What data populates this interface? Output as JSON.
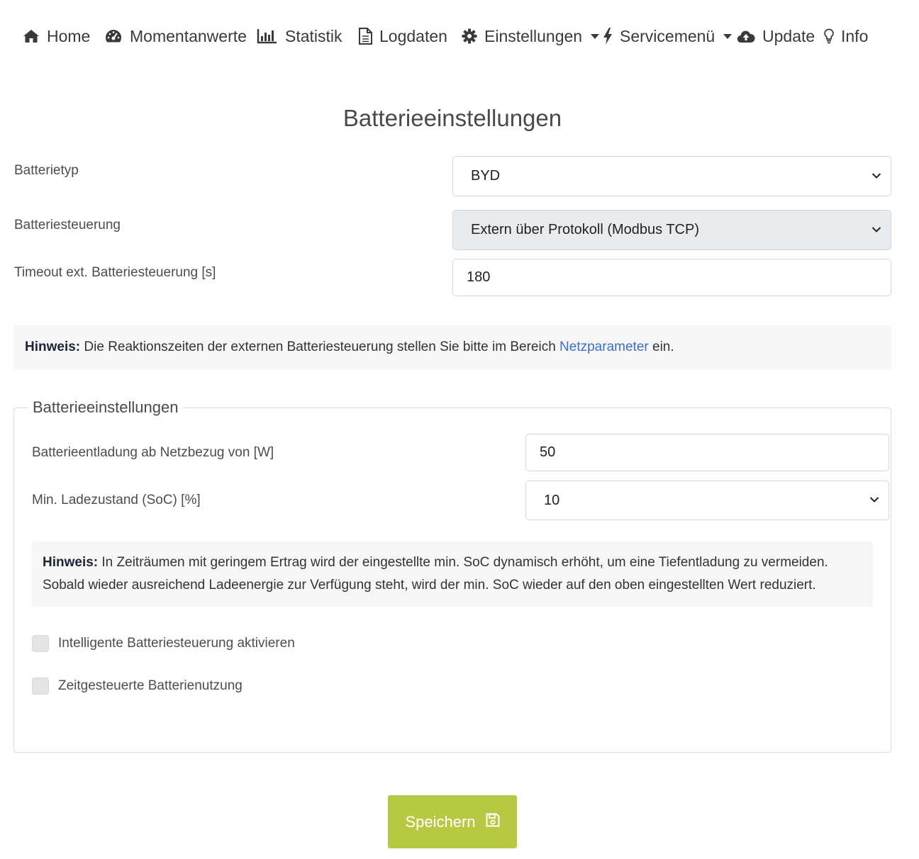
{
  "nav": {
    "home": "Home",
    "momentanwerte": "Momentanwerte",
    "statistik": "Statistik",
    "logdaten": "Logdaten",
    "einstellungen": "Einstellungen",
    "servicemenu": "Servicemenü",
    "update": "Update",
    "info": "Info"
  },
  "page_title": "Batterieeinstellungen",
  "form": {
    "batterietyp_label": "Batterietyp",
    "batterietyp_value": "BYD",
    "steuerung_label": "Batteriesteuerung",
    "steuerung_value": "Extern über Protokoll (Modbus TCP)",
    "timeout_label": "Timeout ext. Batteriesteuerung [s]",
    "timeout_value": "180"
  },
  "hint1": {
    "bold": "Hinweis:",
    "text_before": " Die Reaktionszeiten der externen Batteriesteuerung stellen Sie bitte im Bereich ",
    "link": "Netzparameter",
    "text_after": " ein."
  },
  "fieldset": {
    "legend": "Batterieeinstellungen",
    "entladung_label": "Batterieentladung ab Netzbezug von [W]",
    "entladung_value": "50",
    "soc_label": "Min. Ladezustand (SoC) [%]",
    "soc_value": "10",
    "hint_bold": "Hinweis:",
    "hint_text": " In Zeiträumen mit geringem Ertrag wird der eingestellte min. SoC dynamisch erhöht, um eine Tiefentladung zu vermeiden. Sobald wieder ausreichend Ladeenergie zur Verfügung steht, wird der min. SoC wieder auf den oben eingestellten Wert reduziert.",
    "checkbox1": "Intelligente Batteriesteuerung aktivieren",
    "checkbox2": "Zeitgesteuerte Batterienutzung"
  },
  "save_label": "Speichern",
  "colors": {
    "accent_green": "#b7c943",
    "link_blue": "#3e6fc8",
    "hint_bg": "#f6f6f6"
  }
}
